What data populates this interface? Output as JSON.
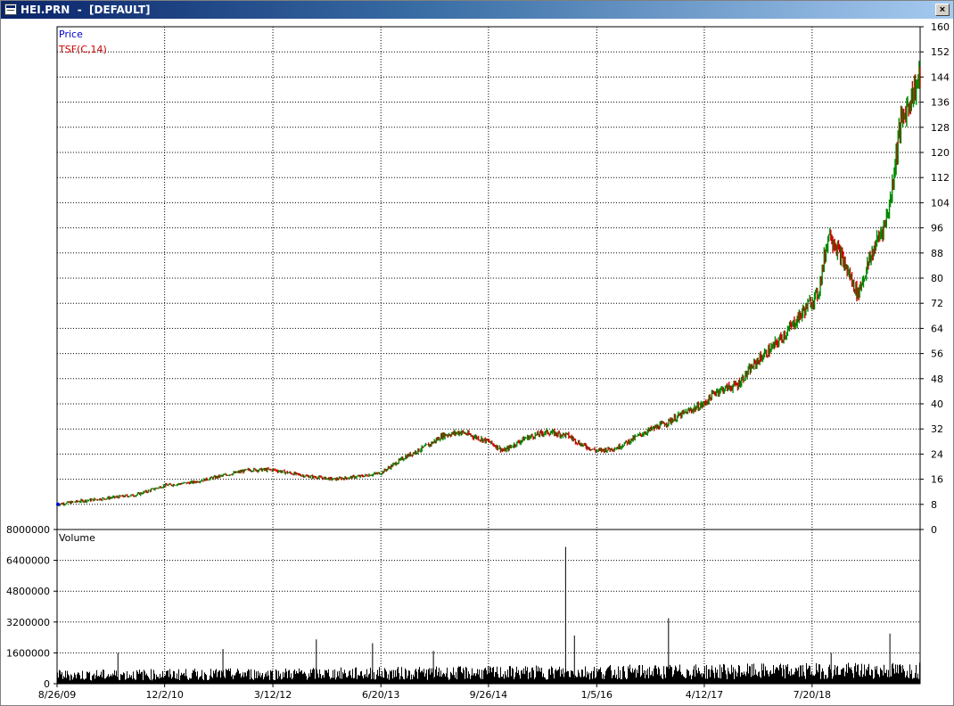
{
  "window": {
    "title": "HEI.PRN  -  [DEFAULT]",
    "close_label": "×"
  },
  "chart_data": [
    {
      "type": "line",
      "panel": "price",
      "legend": [
        "Price",
        "TSF(C,14)"
      ],
      "legend_colors": [
        "#0000cc",
        "#cc0000"
      ],
      "ylim": [
        0,
        160
      ],
      "y_ticks": [
        0,
        8,
        16,
        24,
        32,
        40,
        48,
        56,
        64,
        72,
        80,
        88,
        96,
        104,
        112,
        120,
        128,
        136,
        144,
        152,
        160
      ],
      "x_tick_labels": [
        "8/26/09",
        "12/2/10",
        "3/12/12",
        "6/20/13",
        "9/26/14",
        "1/5/16",
        "4/12/17",
        "7/20/18"
      ],
      "grid": true,
      "up_color": "#008800",
      "down_color": "#cc0000",
      "series": [
        {
          "x": [
            "2009-08-26",
            "2009-12-01",
            "2010-04-01",
            "2010-08-01",
            "2010-12-02",
            "2011-04-01",
            "2011-08-01",
            "2011-12-01",
            "2012-03-12",
            "2012-08-01",
            "2012-12-01",
            "2013-04-01",
            "2013-06-20",
            "2013-10-01",
            "2014-01-15",
            "2014-03-15",
            "2014-06-01",
            "2014-09-26",
            "2014-12-01",
            "2015-03-01",
            "2015-06-01",
            "2015-09-01",
            "2015-11-01",
            "2016-01-05",
            "2016-04-01",
            "2016-08-01",
            "2016-11-01",
            "2017-01-15",
            "2017-04-12",
            "2017-06-01",
            "2017-09-01",
            "2017-12-01",
            "2018-02-01",
            "2018-04-15",
            "2018-07-20",
            "2018-08-15",
            "2018-10-01",
            "2018-12-15",
            "2019-02-01",
            "2019-04-15",
            "2019-06-01",
            "2019-06-20",
            "2019-08-01",
            "2019-09-15",
            "2019-10-28"
          ],
          "y": [
            8,
            9,
            10,
            11,
            14,
            15,
            17,
            19,
            19,
            17,
            16,
            17,
            18,
            23,
            27,
            30,
            31,
            28,
            25,
            29,
            31,
            30,
            27,
            25,
            26,
            31,
            34,
            37,
            40,
            44,
            46,
            54,
            58,
            64,
            73,
            75,
            95,
            83,
            75,
            90,
            98,
            104,
            128,
            137,
            144
          ]
        }
      ]
    },
    {
      "type": "bar",
      "panel": "volume",
      "legend": [
        "Volume"
      ],
      "ylim": [
        0,
        8000000
      ],
      "y_ticks": [
        0,
        1600000,
        3200000,
        4800000,
        6400000,
        8000000
      ],
      "grid": true,
      "color": "#000000",
      "baseline_volume": 700000,
      "spikes": [
        {
          "x": "2015-08-24",
          "value": 7100000
        },
        {
          "x": "2016-11-09",
          "value": 3400000
        },
        {
          "x": "2015-10-01",
          "value": 2500000
        },
        {
          "x": "2019-06-20",
          "value": 2600000
        },
        {
          "x": "2012-09-15",
          "value": 2300000
        },
        {
          "x": "2013-05-15",
          "value": 2100000
        },
        {
          "x": "2014-02-01",
          "value": 1700000
        },
        {
          "x": "2010-05-15",
          "value": 1600000
        },
        {
          "x": "2011-08-10",
          "value": 1800000
        },
        {
          "x": "2018-10-10",
          "value": 1600000
        }
      ]
    }
  ]
}
